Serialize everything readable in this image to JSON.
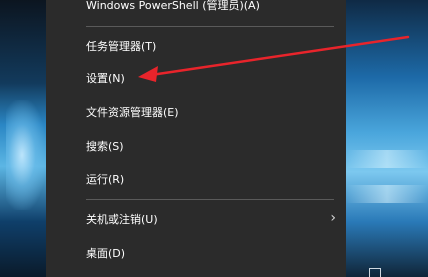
{
  "menu": {
    "items": [
      {
        "label": "Windows PowerShell (管理员)(A)"
      },
      {
        "label": "任务管理器(T)"
      },
      {
        "label": "设置(N)"
      },
      {
        "label": "文件资源管理器(E)"
      },
      {
        "label": "搜索(S)"
      },
      {
        "label": "运行(R)"
      },
      {
        "label": "关机或注销(U)",
        "submenu_icon": "chevron-right-icon"
      },
      {
        "label": "桌面(D)"
      }
    ]
  },
  "annotation": {
    "color": "#e8242b",
    "icon": "red-arrow-icon"
  },
  "colors": {
    "menu_bg": "#2b2b2b",
    "text": "#ffffff",
    "separator": "#5a5a5a"
  }
}
